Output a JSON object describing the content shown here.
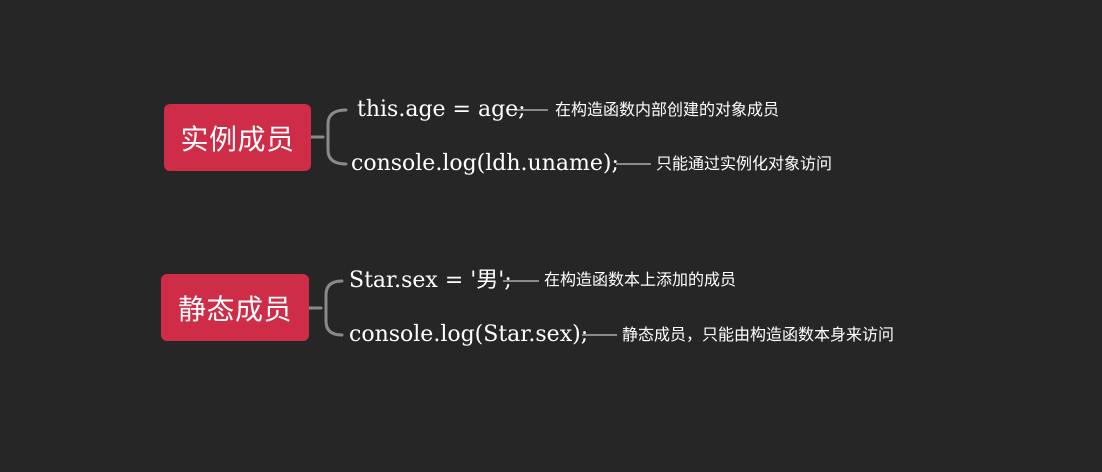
{
  "colors": {
    "background": "#262626",
    "node_fill": "#cf2c47",
    "connector": "#8a8a8a",
    "text": "#ffffff"
  },
  "groups": [
    {
      "title": "实例成员",
      "items": [
        {
          "code": "this.age = age;",
          "note": "在构造函数内部创建的对象成员"
        },
        {
          "code": "console.log(ldh.uname);",
          "note": "只能通过实例化对象访问"
        }
      ]
    },
    {
      "title": "静态成员",
      "items": [
        {
          "code": "Star.sex = '男';",
          "note": "在构造函数本上添加的成员"
        },
        {
          "code": "console.log(Star.sex);",
          "note": "静态成员，只能由构造函数本身来访问"
        }
      ]
    }
  ]
}
